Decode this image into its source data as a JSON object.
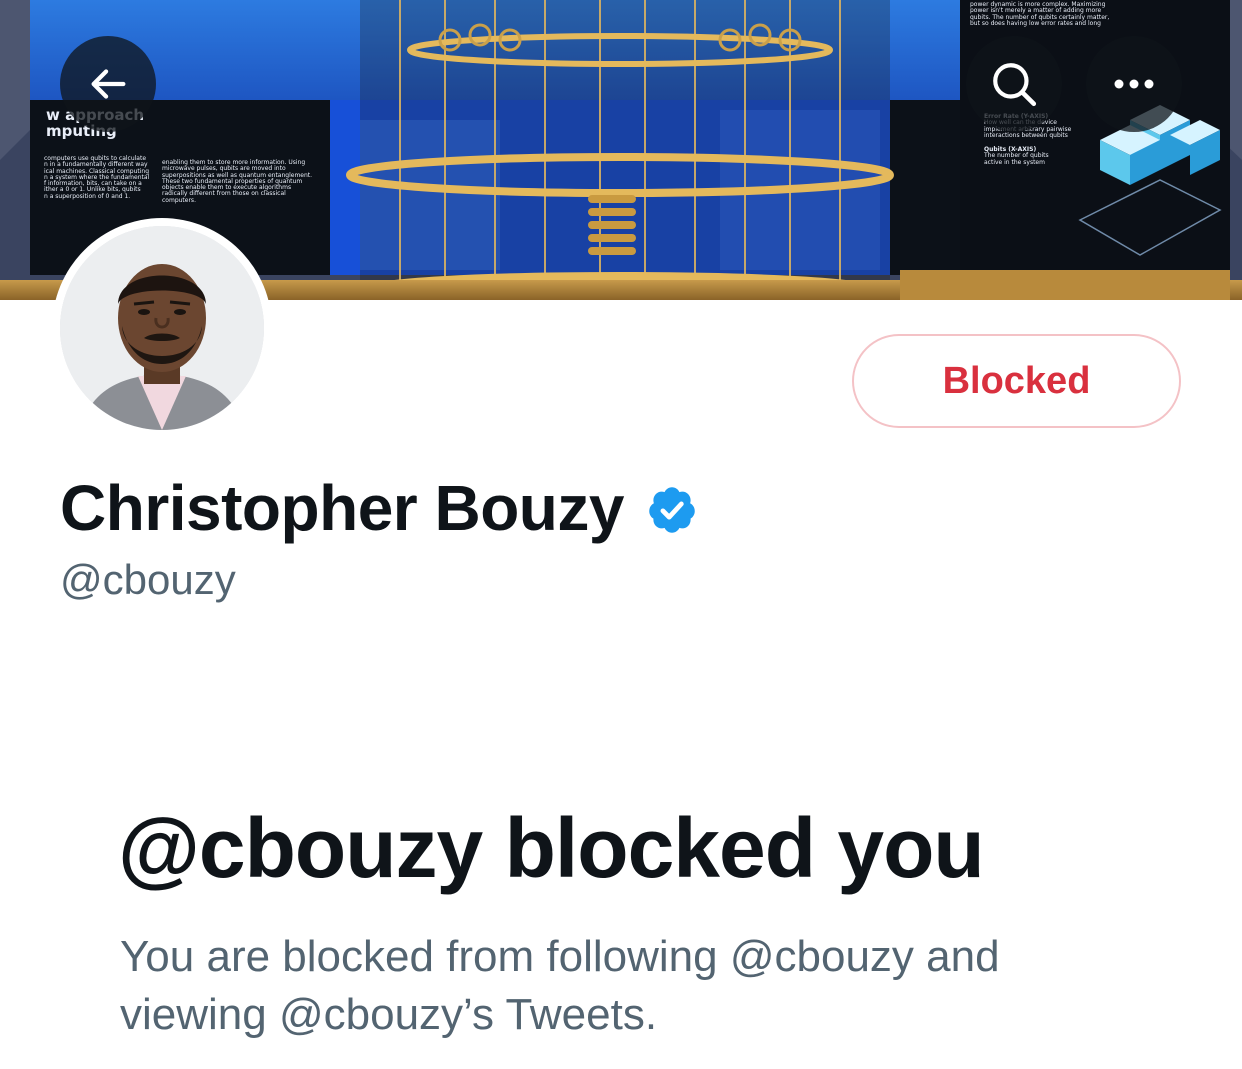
{
  "banner": {
    "left_panel": {
      "heading_line1": "w approach",
      "heading_line2": "mputing",
      "body_lines": [
        "computers use qubits to calculate",
        "n in a fundamentally different way",
        "ical machines. Classical computing",
        "n a system where the fundamental",
        "f information, bits, can take on a",
        "ither a 0 or 1. Unlike bits, qubits",
        "n a superposition of 0 and 1."
      ]
    },
    "mid_panel": {
      "body_lines": [
        "enabling them to store more information. Using",
        "microwave pulses, qubits are moved into",
        "superpositions as well as quantum entanglement.",
        "These two fundamental properties of quantum",
        "objects enable them to execute algorithms",
        "radically different from those on classical",
        "computers."
      ]
    },
    "right_panel": {
      "top_lines": [
        "power dynamic is more complex. Maximizing",
        "power isn't merely a matter of adding more",
        "qubits. The number of qubits certainly matter,",
        "but so does having low error rates and long"
      ],
      "error_label": "Error Rate (Y-AXIS)",
      "error_lines": [
        "How well can the device",
        "implement arbitrary pairwise",
        "interactions between qubits"
      ],
      "qubits_label": "Qubits (X-AXIS)",
      "qubits_lines": [
        "The number of qubits",
        "active in the system"
      ]
    }
  },
  "nav": {
    "back_icon": "arrow-left-icon",
    "search_icon": "search-icon",
    "more_icon": "more-horizontal-icon"
  },
  "profile": {
    "display_name": "Christopher Bouzy",
    "handle": "@cbouzy",
    "verified": true,
    "verified_color": "#1d9bf0",
    "avatar_icon": "profile-photo"
  },
  "actions": {
    "blocked_label": "Blocked",
    "blocked_color": "#d9303e"
  },
  "blocked_message": {
    "title": "@cbouzy blocked you",
    "description": "You are blocked from following @cbouzy and viewing @cbouzy’s Tweets."
  }
}
